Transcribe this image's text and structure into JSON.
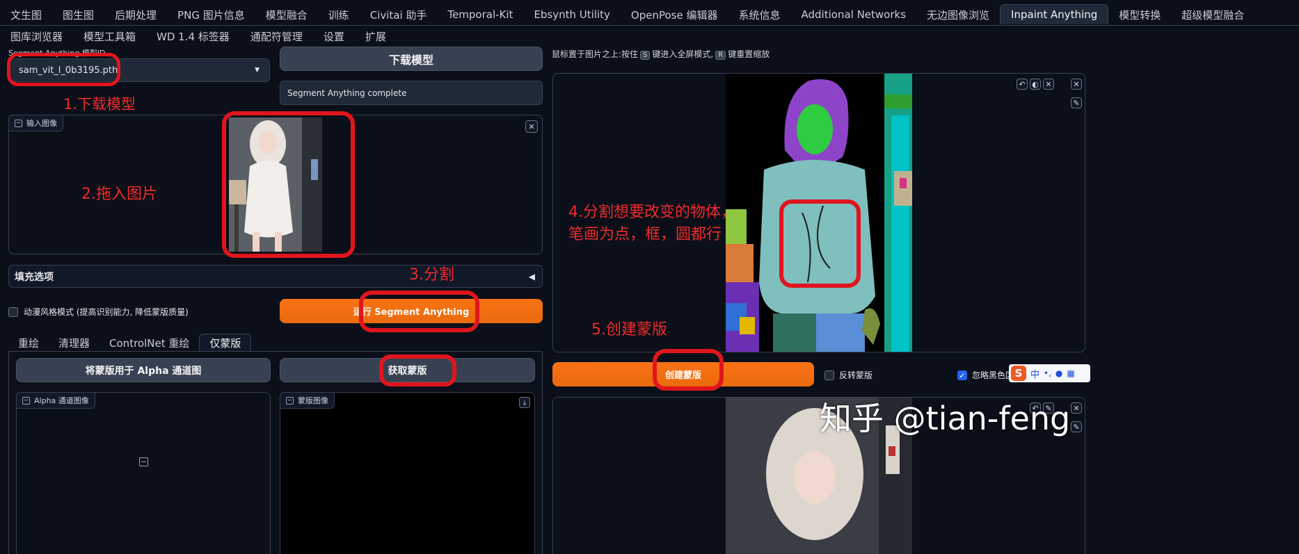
{
  "tabs_row1": [
    "文生图",
    "图生图",
    "后期处理",
    "PNG 图片信息",
    "模型融合",
    "训练",
    "Civitai 助手",
    "Temporal-Kit",
    "Ebsynth Utility",
    "OpenPose 编辑器",
    "系统信息",
    "Additional Networks",
    "无边图像浏览",
    "Inpaint Anything",
    "模型转换",
    "超级模型融合"
  ],
  "tabs_row2": [
    "图库浏览器",
    "模型工具箱",
    "WD 1.4 标签器",
    "通配符管理",
    "设置",
    "扩展"
  ],
  "active_tab": "Inpaint Anything",
  "sam": {
    "label": "Segment Anything 模型ID",
    "selected_model": "sam_vit_l_0b3195.pth",
    "download_button": "下载模型",
    "status": "Segment Anything complete"
  },
  "input_image": {
    "label": "输入图像"
  },
  "fill_options": {
    "label": "填充选项"
  },
  "anime_mode": {
    "label": "动漫风格模式 (提高识别能力, 降低蒙版质量)"
  },
  "run_sam_button": "运行 Segment Anything",
  "hint": {
    "prefix": "鼠标置于图片之上:按住",
    "key_s": "S",
    "middle": "键进入全屏模式,",
    "key_r": "R",
    "suffix": "键重置缩放"
  },
  "subtabs": [
    "重绘",
    "清理器",
    "ControlNet 重绘",
    "仅蒙版"
  ],
  "active_subtab": "仅蒙版",
  "mask_only": {
    "alpha_button": "将蒙版用于 Alpha 通道图",
    "get_mask_button": "获取蒙版",
    "alpha_image_label": "Alpha 通道图像",
    "mask_image_label": "蒙版图像"
  },
  "create_mask_button": "创建蒙版",
  "invert_mask": {
    "label": "反转蒙版"
  },
  "ignore_black": {
    "label": "忽略黑色区"
  },
  "annotations": {
    "step1": "1.下载模型",
    "step2": "2.拖入图片",
    "step3": "3.分割",
    "step4_line1": "4.分割想要改变的物体，",
    "step4_line2": "笔画为点，框，圆都行",
    "step5": "5.创建蒙版"
  },
  "watermark": "知乎 @tian-feng",
  "ime_toolbar": {
    "logo": "S",
    "lang": "中"
  },
  "colors": {
    "accent_orange": "#f97316",
    "annotation_red": "#e0151d",
    "bg": "#0b0f19"
  }
}
